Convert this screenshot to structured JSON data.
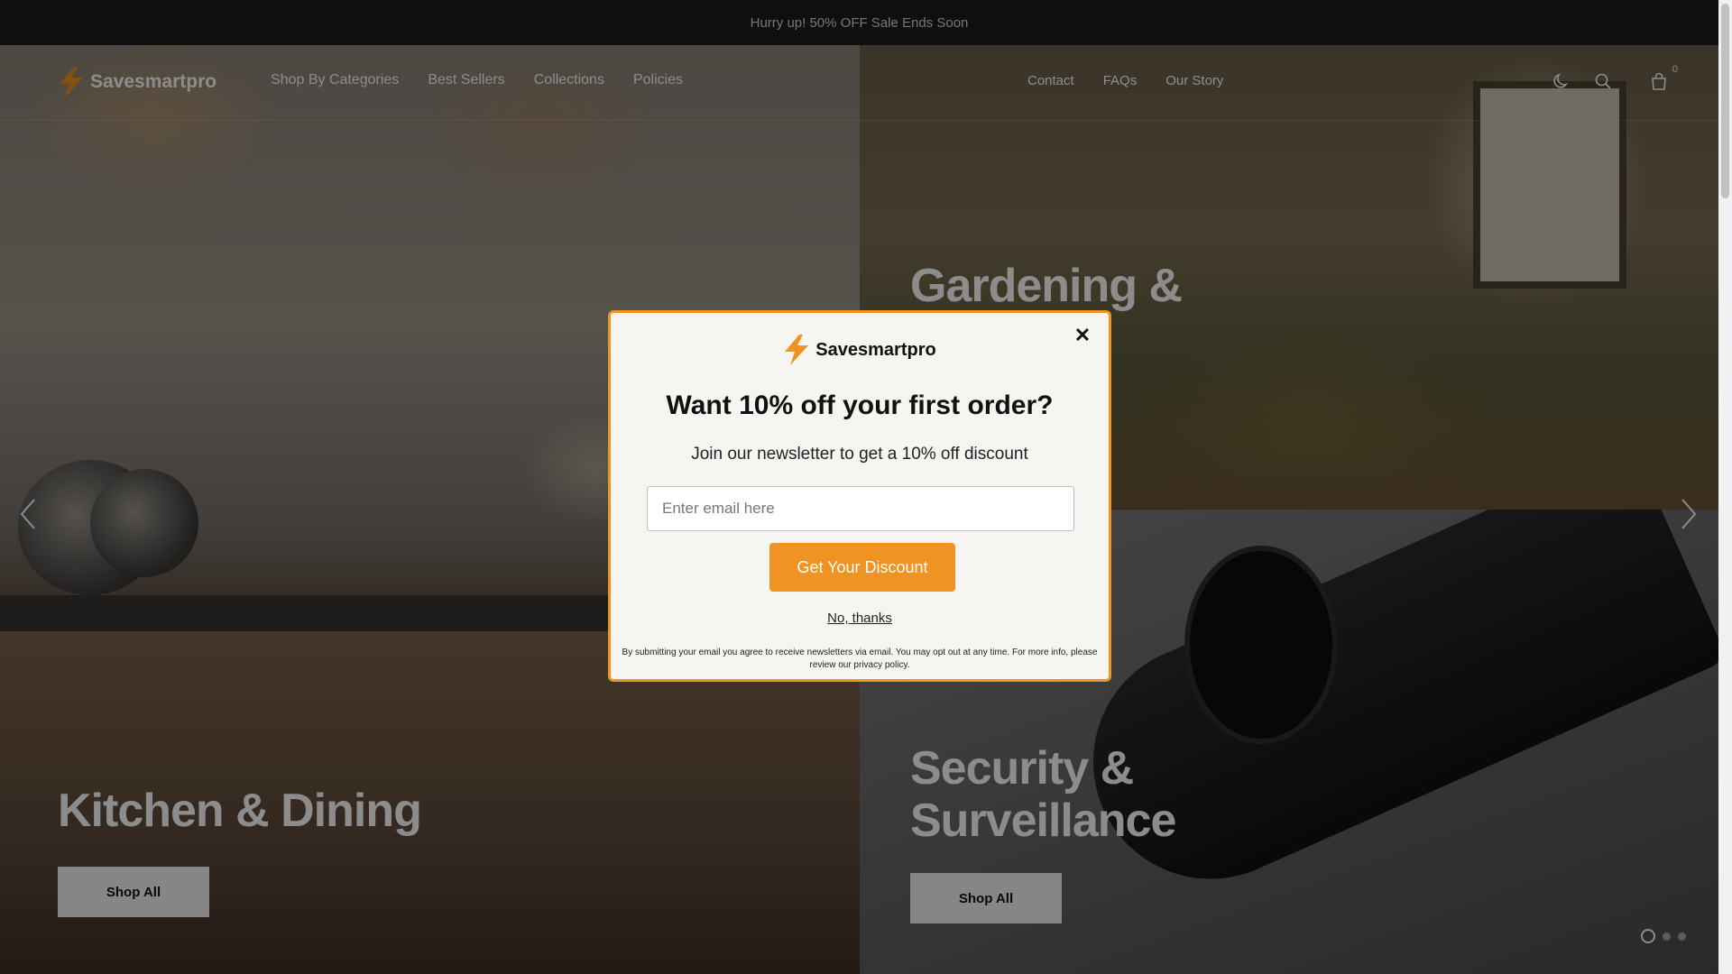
{
  "announcement": {
    "text": "Hurry up! 50% OFF Sale Ends Soon"
  },
  "header": {
    "logo_text": "Savesmartpro",
    "nav_left": [
      {
        "label": "Shop By Categories"
      },
      {
        "label": "Best Sellers"
      },
      {
        "label": "Collections"
      },
      {
        "label": "Policies"
      }
    ],
    "nav_right": [
      {
        "label": "Contact"
      },
      {
        "label": "FAQs"
      },
      {
        "label": "Our Story"
      }
    ],
    "icons": [
      "moon-icon",
      "search-icon",
      "cart-icon"
    ],
    "cart_count": "0"
  },
  "hero": {
    "panels": [
      {
        "title": "Kitchen & Dining",
        "button": "Shop All"
      },
      {
        "title": "Gardening & Outdoor Life",
        "title_visible": "Gardening &"
      },
      {
        "title": "Security & Surveillance",
        "title_line1": "Security &",
        "title_line2": "Surveillance",
        "button": "Shop All"
      }
    ],
    "slides_total": 3,
    "active_slide": 1
  },
  "popup": {
    "logo_text": "Savesmartpro",
    "heading": "Want 10% off your first order?",
    "subheading": "Join our newsletter to get a 10% off discount",
    "email_placeholder": "Enter email here",
    "email_value": "",
    "cta_label": "Get Your Discount",
    "dismiss_label": "No, thanks",
    "legal_text": "By submitting your email you agree to receive newsletters via email. You may opt out at any time. For more info, please review our privacy policy.",
    "close_symbol": "✕"
  },
  "colors": {
    "accent": "#ef9322",
    "announcement_bg": "#1c1c1c",
    "popup_bg": "#f7f5f2"
  }
}
